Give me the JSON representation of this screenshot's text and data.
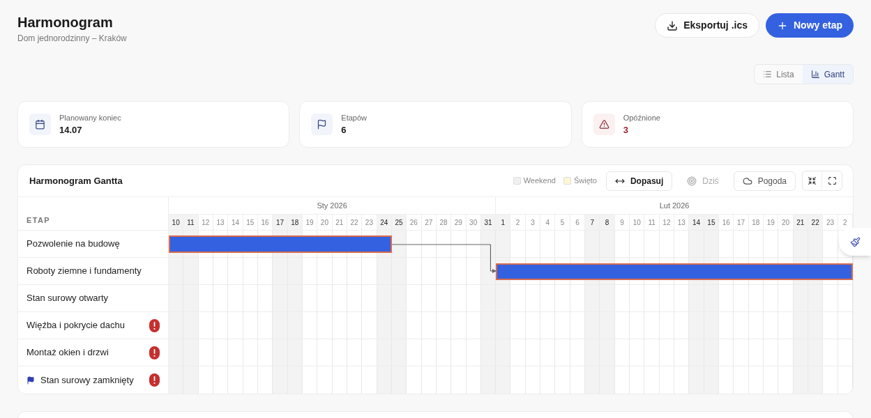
{
  "header": {
    "title": "Harmonogram",
    "subtitle": "Dom jednorodzinny – Kraków"
  },
  "actions": [
    {
      "kind": "export",
      "label": "Eksportuj .ics"
    },
    {
      "kind": "add",
      "label": "Nowy etap"
    }
  ],
  "view_toggle": [
    {
      "kind": "list",
      "label": "Lista",
      "selected": false
    },
    {
      "kind": "gantt",
      "label": "Gantt",
      "selected": true
    }
  ],
  "stats": [
    {
      "kind": "calendar",
      "label": "Planowany koniec",
      "value": "14.07"
    },
    {
      "kind": "flag",
      "label": "Etapów",
      "value": "6"
    },
    {
      "kind": "warning",
      "label": "Opóźnione",
      "value": "3"
    }
  ],
  "gantt": {
    "title": "Harmonogram Gantta",
    "legend": [
      {
        "label": "Weekend",
        "color": "#f0f0f0"
      },
      {
        "label": "Święto",
        "color": "#fdf7d6"
      }
    ],
    "tools": [
      {
        "kind": "fit",
        "label": "Dopasuj",
        "selected": true,
        "disabled": false
      },
      {
        "kind": "today",
        "label": "Dziś",
        "selected": false,
        "disabled": true
      },
      {
        "kind": "weather",
        "label": "Pogoda",
        "selected": false,
        "disabled": false
      },
      {
        "kind": "collapse",
        "selected": false,
        "disabled": false
      },
      {
        "kind": "expand",
        "selected": false,
        "disabled": false
      }
    ],
    "column_heading": "ETAP",
    "months": [
      {
        "label": "Sty 2026",
        "days": [
          {
            "label": "10",
            "weekend": true
          },
          {
            "label": "11",
            "weekend": true
          },
          {
            "label": "12",
            "weekend": false
          },
          {
            "label": "13",
            "weekend": false
          },
          {
            "label": "14",
            "weekend": false
          },
          {
            "label": "15",
            "weekend": false
          },
          {
            "label": "16",
            "weekend": false
          },
          {
            "label": "17",
            "weekend": true
          },
          {
            "label": "18",
            "weekend": true
          },
          {
            "label": "19",
            "weekend": false
          },
          {
            "label": "20",
            "weekend": false
          },
          {
            "label": "21",
            "weekend": false
          },
          {
            "label": "22",
            "weekend": false
          },
          {
            "label": "23",
            "weekend": false
          },
          {
            "label": "24",
            "weekend": true
          },
          {
            "label": "25",
            "weekend": true
          },
          {
            "label": "26",
            "weekend": false
          },
          {
            "label": "27",
            "weekend": false
          },
          {
            "label": "28",
            "weekend": false
          },
          {
            "label": "29",
            "weekend": false
          },
          {
            "label": "30",
            "weekend": false
          },
          {
            "label": "31",
            "weekend": true
          }
        ]
      },
      {
        "label": "Lut 2026",
        "days": [
          {
            "label": "1",
            "weekend": true
          },
          {
            "label": "2",
            "weekend": false
          },
          {
            "label": "3",
            "weekend": false
          },
          {
            "label": "4",
            "weekend": false
          },
          {
            "label": "5",
            "weekend": false
          },
          {
            "label": "6",
            "weekend": false
          },
          {
            "label": "7",
            "weekend": true
          },
          {
            "label": "8",
            "weekend": true
          },
          {
            "label": "9",
            "weekend": false
          },
          {
            "label": "10",
            "weekend": false
          },
          {
            "label": "11",
            "weekend": false
          },
          {
            "label": "12",
            "weekend": false
          },
          {
            "label": "13",
            "weekend": false
          },
          {
            "label": "14",
            "weekend": true
          },
          {
            "label": "15",
            "weekend": true
          },
          {
            "label": "16",
            "weekend": false
          },
          {
            "label": "17",
            "weekend": false
          },
          {
            "label": "18",
            "weekend": false
          },
          {
            "label": "19",
            "weekend": false
          },
          {
            "label": "20",
            "weekend": false
          },
          {
            "label": "21",
            "weekend": true
          },
          {
            "label": "22",
            "weekend": true
          },
          {
            "label": "23",
            "weekend": false
          },
          {
            "label": "2",
            "weekend": false
          }
        ]
      }
    ],
    "stages": [
      {
        "name": "Pozwolenie na budowę",
        "milestone": false,
        "delayed": false,
        "bar": {
          "kind": "from_left",
          "level": 0.326
        },
        "linked_to_previous": false
      },
      {
        "name": "Roboty ziemne i fundamenty",
        "milestone": false,
        "delayed": false,
        "bar": {
          "kind": "to_right",
          "level": 0.522
        },
        "linked_to_previous": true
      },
      {
        "name": "Stan surowy otwarty",
        "milestone": false,
        "delayed": false
      },
      {
        "name": "Więźba i pokrycie dachu",
        "milestone": false,
        "delayed": true
      },
      {
        "name": "Montaż okien i drzwi",
        "milestone": false,
        "delayed": true
      },
      {
        "name": "Stan surowy zamknięty",
        "milestone": true,
        "delayed": true
      }
    ]
  }
}
